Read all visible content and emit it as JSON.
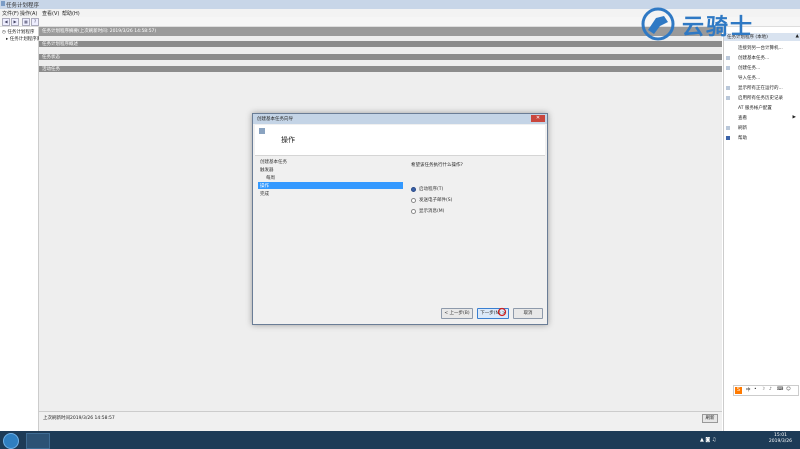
{
  "window": {
    "title": "任务计划程序"
  },
  "menu": [
    "文件(F)",
    "操作(A)",
    "查看(V)",
    "帮助(H)"
  ],
  "tree": {
    "root": "任务计划程序",
    "child": "任务计划程序库"
  },
  "center": {
    "status_line": "任务计划程序摘要(上次刷新时间: 2019/3/26 14:58:57)",
    "band1": "任务计划程序概述",
    "band2": "任务状态",
    "band3": "活动任务",
    "footer_refresh": "上次刷新时间2019/3/26 14:58:57",
    "refresh_button": "刷新"
  },
  "actions": {
    "header": "任务计划程序 (本地)",
    "items": [
      "连接到另一台计算机...",
      "创建基本任务...",
      "创建任务...",
      "导入任务...",
      "显示所有正在运行的...",
      "启用所有任务历史记录",
      "AT 服务帐户配置",
      "查看",
      "刷新",
      "帮助"
    ]
  },
  "dialog": {
    "title": "创建基本任务向导",
    "close": "✕",
    "heading": "操作",
    "steps": [
      "创建基本任务",
      "触发器",
      "每周",
      "操作",
      "完成"
    ],
    "selected_step": 3,
    "question": "希望该任务执行什么操作?",
    "options": [
      "启动程序(T)",
      "发送电子邮件(S)",
      "显示消息(M)"
    ],
    "selected_option": 0,
    "buttons": {
      "back": "< 上一步(B)",
      "next": "下一步(N) >",
      "cancel": "取消"
    }
  },
  "taskbar": {
    "time": "15:01",
    "date": "2019/3/26"
  },
  "ime": {
    "logo": "S",
    "symbols": [
      "中",
      "•",
      "☽",
      "♪"
    ]
  },
  "watermark": {
    "text": "云骑士"
  },
  "colors": {
    "selection": "#3399ff",
    "band": "#8c8c8c",
    "taskbar": "#1d3b57",
    "watermark": "#2f79c4"
  }
}
